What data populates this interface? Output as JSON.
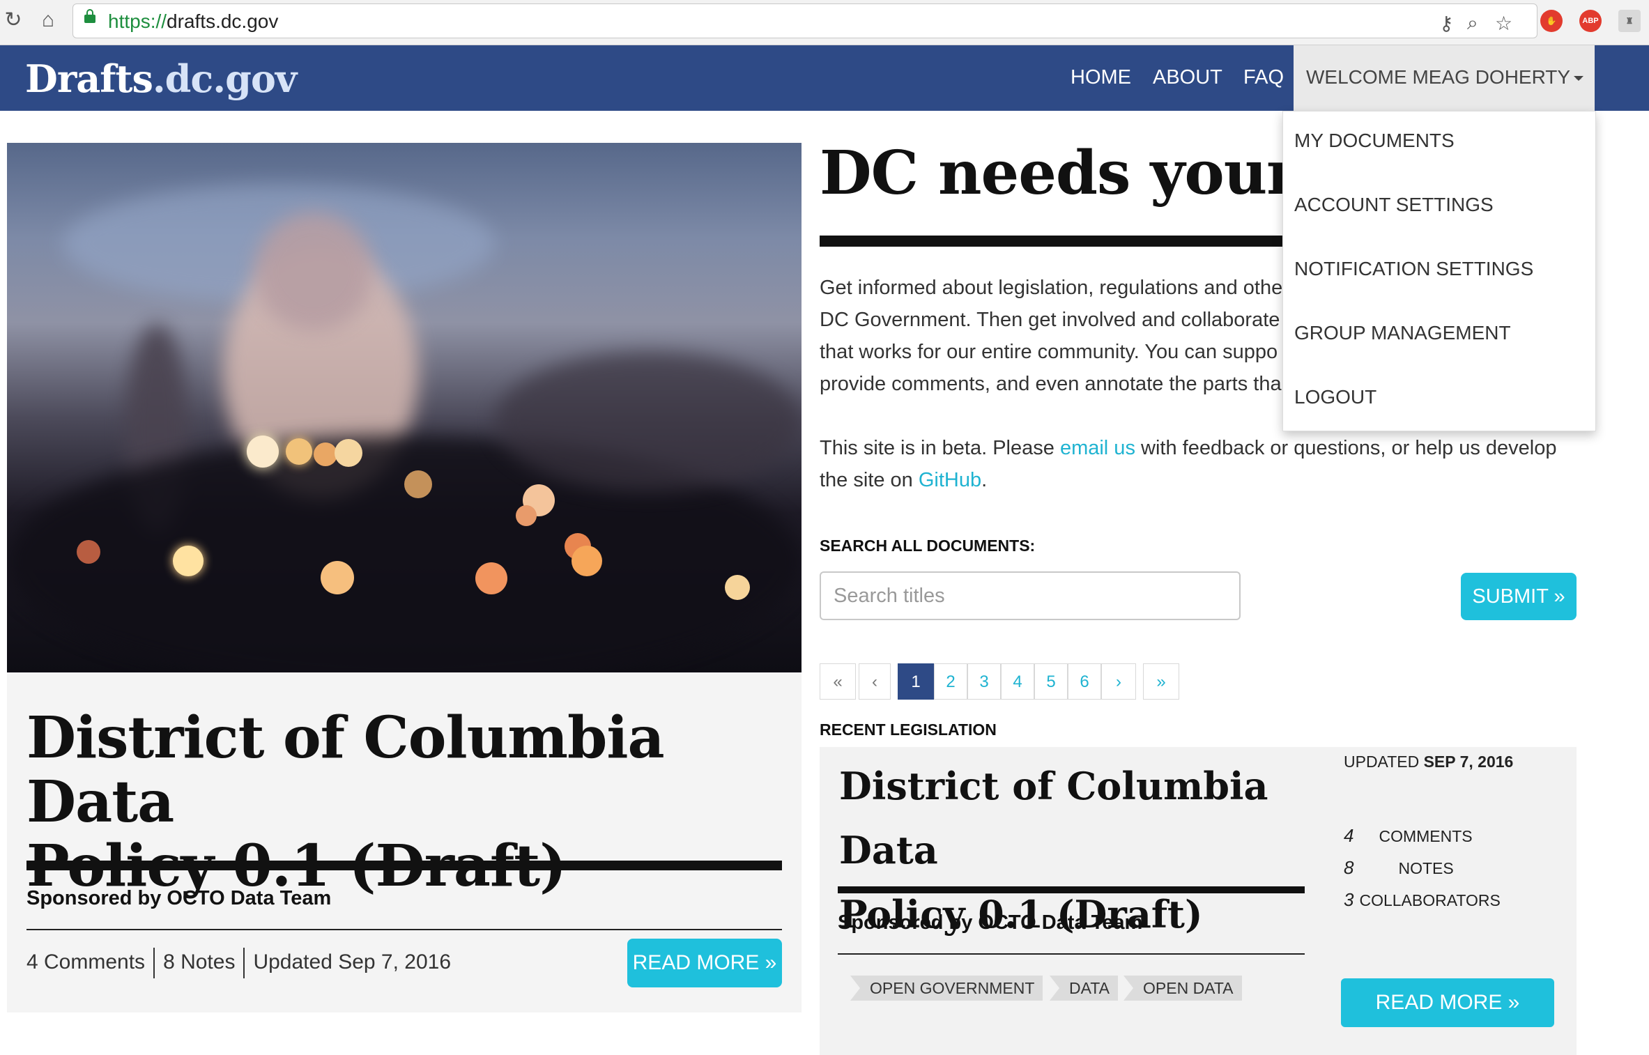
{
  "browser": {
    "url_protocol": "https://",
    "url_host": "drafts.dc.gov",
    "ext_abp": "ABP"
  },
  "site": {
    "logo_main": "Drafts",
    "logo_tld": ".dc.gov",
    "nav": [
      "HOME",
      "ABOUT",
      "FAQ"
    ],
    "welcome": "WELCOME MEAG DOHERTY -",
    "dropdown": [
      "MY DOCUMENTS",
      "ACCOUNT SETTINGS",
      "NOTIFICATION SETTINGS",
      "GROUP MANAGEMENT",
      "LOGOUT"
    ]
  },
  "feature": {
    "title_line1": "District of Columbia Data",
    "title_line2": "Policy 0.1 (Draft)",
    "sponsor": "Sponsored by OCTO Data Team",
    "comments": "4 Comments",
    "notes": "8 Notes",
    "updated": "Updated Sep 7, 2016",
    "read_more": "READ MORE »",
    "below_partial": "... ... ... ... ..."
  },
  "main": {
    "headline": "DC needs your v",
    "intro_lines": [
      "Get informed about legislation, regulations and othe",
      "DC Government. Then get involved and collaborate",
      "that works for our entire community. You can suppo",
      "provide comments, and even annotate the parts tha"
    ],
    "beta_pre": "This site is in beta. Please ",
    "beta_link1": "email us",
    "beta_mid": " with feedback or questions, or help us develop",
    "beta_pre2": "the site on ",
    "beta_link2": "GitHub",
    "beta_post": ".",
    "search_label": "SEARCH ALL DOCUMENTS:",
    "search_placeholder": "Search titles",
    "submit": "SUBMIT »",
    "pagination": [
      "«",
      "‹",
      "1",
      "2",
      "3",
      "4",
      "5",
      "6",
      "›",
      "»"
    ],
    "current_page": "1",
    "recent_label": "RECENT LEGISLATION"
  },
  "recent": {
    "title_line1": "District of Columbia Data",
    "title_line2": "Policy 0.1 (Draft)",
    "sponsor": "Sponsored by OCTO Data Team",
    "tags": [
      "OPEN GOVERNMENT",
      "DATA",
      "OPEN DATA"
    ],
    "updated_label": "UPDATED ",
    "updated_date": "SEP 7, 2016",
    "stats": [
      {
        "num": "4",
        "label": "COMMENTS"
      },
      {
        "num": "8",
        "label": "NOTES"
      },
      {
        "num": "3",
        "label": "COLLABORATORS"
      }
    ],
    "read_more": "READ MORE »"
  },
  "colors": {
    "navbar": "#2e4a86",
    "accent_cyan": "#1fc0dc",
    "link": "#1fb3d1"
  }
}
